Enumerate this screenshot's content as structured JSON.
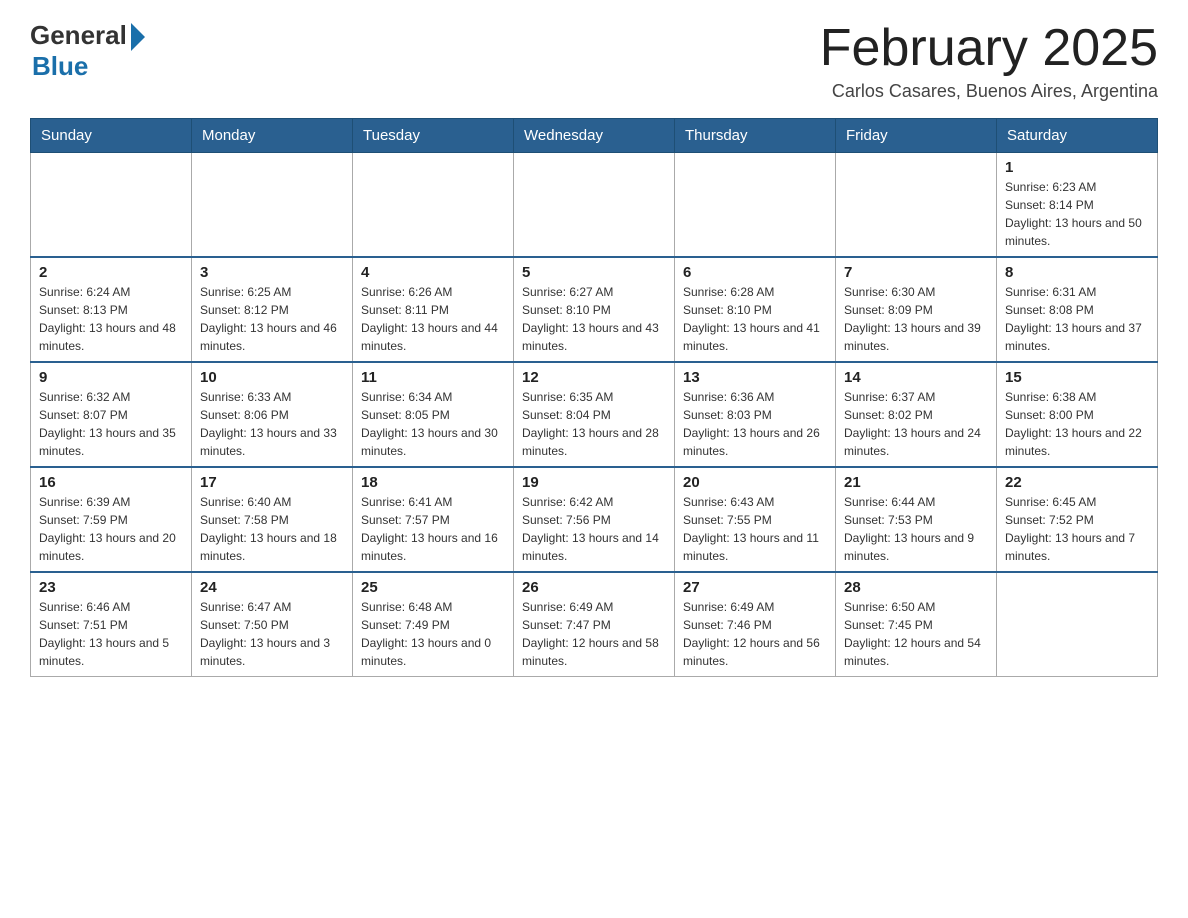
{
  "header": {
    "logo_general": "General",
    "logo_blue": "Blue",
    "month_title": "February 2025",
    "subtitle": "Carlos Casares, Buenos Aires, Argentina"
  },
  "weekdays": [
    "Sunday",
    "Monday",
    "Tuesday",
    "Wednesday",
    "Thursday",
    "Friday",
    "Saturday"
  ],
  "weeks": [
    [
      {
        "day": "",
        "info": ""
      },
      {
        "day": "",
        "info": ""
      },
      {
        "day": "",
        "info": ""
      },
      {
        "day": "",
        "info": ""
      },
      {
        "day": "",
        "info": ""
      },
      {
        "day": "",
        "info": ""
      },
      {
        "day": "1",
        "info": "Sunrise: 6:23 AM\nSunset: 8:14 PM\nDaylight: 13 hours and 50 minutes."
      }
    ],
    [
      {
        "day": "2",
        "info": "Sunrise: 6:24 AM\nSunset: 8:13 PM\nDaylight: 13 hours and 48 minutes."
      },
      {
        "day": "3",
        "info": "Sunrise: 6:25 AM\nSunset: 8:12 PM\nDaylight: 13 hours and 46 minutes."
      },
      {
        "day": "4",
        "info": "Sunrise: 6:26 AM\nSunset: 8:11 PM\nDaylight: 13 hours and 44 minutes."
      },
      {
        "day": "5",
        "info": "Sunrise: 6:27 AM\nSunset: 8:10 PM\nDaylight: 13 hours and 43 minutes."
      },
      {
        "day": "6",
        "info": "Sunrise: 6:28 AM\nSunset: 8:10 PM\nDaylight: 13 hours and 41 minutes."
      },
      {
        "day": "7",
        "info": "Sunrise: 6:30 AM\nSunset: 8:09 PM\nDaylight: 13 hours and 39 minutes."
      },
      {
        "day": "8",
        "info": "Sunrise: 6:31 AM\nSunset: 8:08 PM\nDaylight: 13 hours and 37 minutes."
      }
    ],
    [
      {
        "day": "9",
        "info": "Sunrise: 6:32 AM\nSunset: 8:07 PM\nDaylight: 13 hours and 35 minutes."
      },
      {
        "day": "10",
        "info": "Sunrise: 6:33 AM\nSunset: 8:06 PM\nDaylight: 13 hours and 33 minutes."
      },
      {
        "day": "11",
        "info": "Sunrise: 6:34 AM\nSunset: 8:05 PM\nDaylight: 13 hours and 30 minutes."
      },
      {
        "day": "12",
        "info": "Sunrise: 6:35 AM\nSunset: 8:04 PM\nDaylight: 13 hours and 28 minutes."
      },
      {
        "day": "13",
        "info": "Sunrise: 6:36 AM\nSunset: 8:03 PM\nDaylight: 13 hours and 26 minutes."
      },
      {
        "day": "14",
        "info": "Sunrise: 6:37 AM\nSunset: 8:02 PM\nDaylight: 13 hours and 24 minutes."
      },
      {
        "day": "15",
        "info": "Sunrise: 6:38 AM\nSunset: 8:00 PM\nDaylight: 13 hours and 22 minutes."
      }
    ],
    [
      {
        "day": "16",
        "info": "Sunrise: 6:39 AM\nSunset: 7:59 PM\nDaylight: 13 hours and 20 minutes."
      },
      {
        "day": "17",
        "info": "Sunrise: 6:40 AM\nSunset: 7:58 PM\nDaylight: 13 hours and 18 minutes."
      },
      {
        "day": "18",
        "info": "Sunrise: 6:41 AM\nSunset: 7:57 PM\nDaylight: 13 hours and 16 minutes."
      },
      {
        "day": "19",
        "info": "Sunrise: 6:42 AM\nSunset: 7:56 PM\nDaylight: 13 hours and 14 minutes."
      },
      {
        "day": "20",
        "info": "Sunrise: 6:43 AM\nSunset: 7:55 PM\nDaylight: 13 hours and 11 minutes."
      },
      {
        "day": "21",
        "info": "Sunrise: 6:44 AM\nSunset: 7:53 PM\nDaylight: 13 hours and 9 minutes."
      },
      {
        "day": "22",
        "info": "Sunrise: 6:45 AM\nSunset: 7:52 PM\nDaylight: 13 hours and 7 minutes."
      }
    ],
    [
      {
        "day": "23",
        "info": "Sunrise: 6:46 AM\nSunset: 7:51 PM\nDaylight: 13 hours and 5 minutes."
      },
      {
        "day": "24",
        "info": "Sunrise: 6:47 AM\nSunset: 7:50 PM\nDaylight: 13 hours and 3 minutes."
      },
      {
        "day": "25",
        "info": "Sunrise: 6:48 AM\nSunset: 7:49 PM\nDaylight: 13 hours and 0 minutes."
      },
      {
        "day": "26",
        "info": "Sunrise: 6:49 AM\nSunset: 7:47 PM\nDaylight: 12 hours and 58 minutes."
      },
      {
        "day": "27",
        "info": "Sunrise: 6:49 AM\nSunset: 7:46 PM\nDaylight: 12 hours and 56 minutes."
      },
      {
        "day": "28",
        "info": "Sunrise: 6:50 AM\nSunset: 7:45 PM\nDaylight: 12 hours and 54 minutes."
      },
      {
        "day": "",
        "info": ""
      }
    ]
  ]
}
